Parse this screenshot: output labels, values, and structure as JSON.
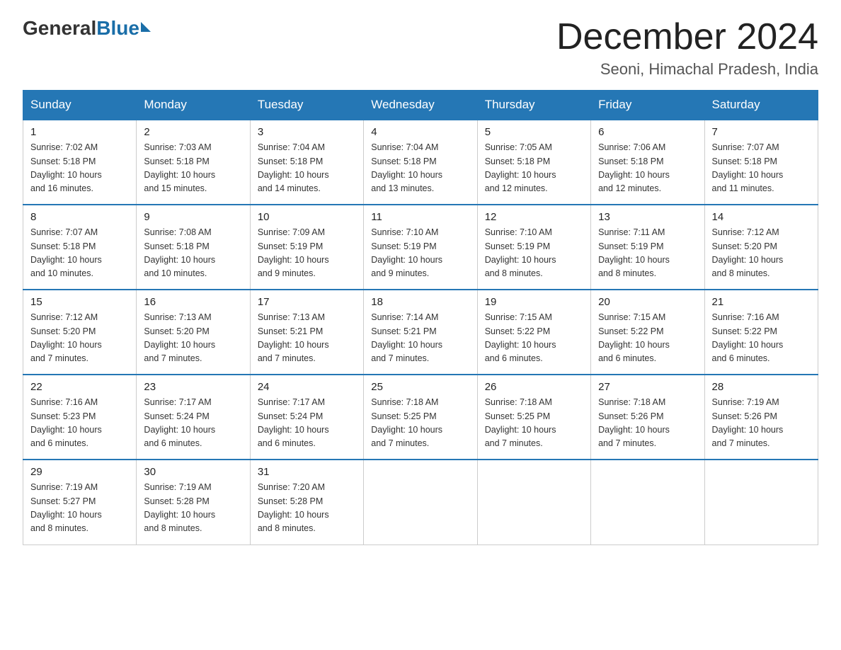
{
  "header": {
    "logo_general": "General",
    "logo_blue": "Blue",
    "month_title": "December 2024",
    "location": "Seoni, Himachal Pradesh, India"
  },
  "weekdays": [
    "Sunday",
    "Monday",
    "Tuesday",
    "Wednesday",
    "Thursday",
    "Friday",
    "Saturday"
  ],
  "weeks": [
    [
      {
        "day": "1",
        "sunrise": "7:02 AM",
        "sunset": "5:18 PM",
        "daylight": "10 hours and 16 minutes."
      },
      {
        "day": "2",
        "sunrise": "7:03 AM",
        "sunset": "5:18 PM",
        "daylight": "10 hours and 15 minutes."
      },
      {
        "day": "3",
        "sunrise": "7:04 AM",
        "sunset": "5:18 PM",
        "daylight": "10 hours and 14 minutes."
      },
      {
        "day": "4",
        "sunrise": "7:04 AM",
        "sunset": "5:18 PM",
        "daylight": "10 hours and 13 minutes."
      },
      {
        "day": "5",
        "sunrise": "7:05 AM",
        "sunset": "5:18 PM",
        "daylight": "10 hours and 12 minutes."
      },
      {
        "day": "6",
        "sunrise": "7:06 AM",
        "sunset": "5:18 PM",
        "daylight": "10 hours and 12 minutes."
      },
      {
        "day": "7",
        "sunrise": "7:07 AM",
        "sunset": "5:18 PM",
        "daylight": "10 hours and 11 minutes."
      }
    ],
    [
      {
        "day": "8",
        "sunrise": "7:07 AM",
        "sunset": "5:18 PM",
        "daylight": "10 hours and 10 minutes."
      },
      {
        "day": "9",
        "sunrise": "7:08 AM",
        "sunset": "5:18 PM",
        "daylight": "10 hours and 10 minutes."
      },
      {
        "day": "10",
        "sunrise": "7:09 AM",
        "sunset": "5:19 PM",
        "daylight": "10 hours and 9 minutes."
      },
      {
        "day": "11",
        "sunrise": "7:10 AM",
        "sunset": "5:19 PM",
        "daylight": "10 hours and 9 minutes."
      },
      {
        "day": "12",
        "sunrise": "7:10 AM",
        "sunset": "5:19 PM",
        "daylight": "10 hours and 8 minutes."
      },
      {
        "day": "13",
        "sunrise": "7:11 AM",
        "sunset": "5:19 PM",
        "daylight": "10 hours and 8 minutes."
      },
      {
        "day": "14",
        "sunrise": "7:12 AM",
        "sunset": "5:20 PM",
        "daylight": "10 hours and 8 minutes."
      }
    ],
    [
      {
        "day": "15",
        "sunrise": "7:12 AM",
        "sunset": "5:20 PM",
        "daylight": "10 hours and 7 minutes."
      },
      {
        "day": "16",
        "sunrise": "7:13 AM",
        "sunset": "5:20 PM",
        "daylight": "10 hours and 7 minutes."
      },
      {
        "day": "17",
        "sunrise": "7:13 AM",
        "sunset": "5:21 PM",
        "daylight": "10 hours and 7 minutes."
      },
      {
        "day": "18",
        "sunrise": "7:14 AM",
        "sunset": "5:21 PM",
        "daylight": "10 hours and 7 minutes."
      },
      {
        "day": "19",
        "sunrise": "7:15 AM",
        "sunset": "5:22 PM",
        "daylight": "10 hours and 6 minutes."
      },
      {
        "day": "20",
        "sunrise": "7:15 AM",
        "sunset": "5:22 PM",
        "daylight": "10 hours and 6 minutes."
      },
      {
        "day": "21",
        "sunrise": "7:16 AM",
        "sunset": "5:22 PM",
        "daylight": "10 hours and 6 minutes."
      }
    ],
    [
      {
        "day": "22",
        "sunrise": "7:16 AM",
        "sunset": "5:23 PM",
        "daylight": "10 hours and 6 minutes."
      },
      {
        "day": "23",
        "sunrise": "7:17 AM",
        "sunset": "5:24 PM",
        "daylight": "10 hours and 6 minutes."
      },
      {
        "day": "24",
        "sunrise": "7:17 AM",
        "sunset": "5:24 PM",
        "daylight": "10 hours and 6 minutes."
      },
      {
        "day": "25",
        "sunrise": "7:18 AM",
        "sunset": "5:25 PM",
        "daylight": "10 hours and 7 minutes."
      },
      {
        "day": "26",
        "sunrise": "7:18 AM",
        "sunset": "5:25 PM",
        "daylight": "10 hours and 7 minutes."
      },
      {
        "day": "27",
        "sunrise": "7:18 AM",
        "sunset": "5:26 PM",
        "daylight": "10 hours and 7 minutes."
      },
      {
        "day": "28",
        "sunrise": "7:19 AM",
        "sunset": "5:26 PM",
        "daylight": "10 hours and 7 minutes."
      }
    ],
    [
      {
        "day": "29",
        "sunrise": "7:19 AM",
        "sunset": "5:27 PM",
        "daylight": "10 hours and 8 minutes."
      },
      {
        "day": "30",
        "sunrise": "7:19 AM",
        "sunset": "5:28 PM",
        "daylight": "10 hours and 8 minutes."
      },
      {
        "day": "31",
        "sunrise": "7:20 AM",
        "sunset": "5:28 PM",
        "daylight": "10 hours and 8 minutes."
      },
      null,
      null,
      null,
      null
    ]
  ]
}
